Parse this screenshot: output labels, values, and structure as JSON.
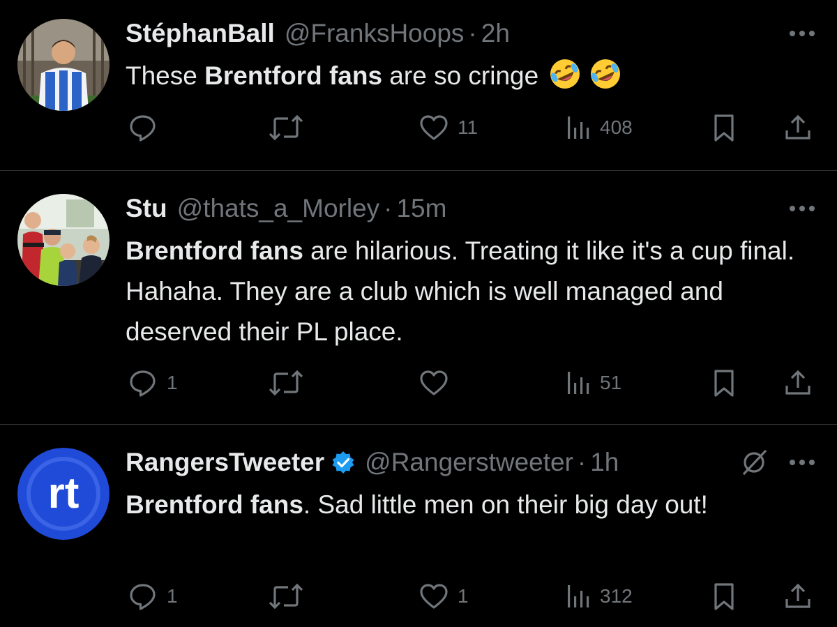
{
  "tweets": [
    {
      "name": "StéphanBall",
      "handle": "@FranksHoops",
      "dot": "·",
      "time": "2h",
      "verified": false,
      "muted": false,
      "body": [
        {
          "text": "These ",
          "bold": false
        },
        {
          "text": "Brentford fans",
          "bold": true
        },
        {
          "text": " are so cringe",
          "bold": false
        }
      ],
      "emojis": [
        "rolling-on-floor-laughing",
        "rolling-on-floor-laughing"
      ],
      "stats": {
        "replies": "",
        "retweets": "",
        "likes": "11",
        "views": "408"
      }
    },
    {
      "name": "Stu",
      "handle": "@thats_a_Morley",
      "dot": "·",
      "time": "15m",
      "verified": false,
      "muted": false,
      "body": [
        {
          "text": "Brentford fans",
          "bold": true
        },
        {
          "text": " are hilarious. Treating it like it's a cup final. Hahaha. They are a club which is well managed and deserved their PL place.",
          "bold": false
        }
      ],
      "stats": {
        "replies": "1",
        "retweets": "",
        "likes": "",
        "views": "51"
      }
    },
    {
      "name": "RangersTweeter",
      "handle": "@Rangerstweeter",
      "dot": "·",
      "time": "1h",
      "verified": true,
      "muted": true,
      "avatar_text": "rt",
      "body": [
        {
          "text": "Brentford fans",
          "bold": true
        },
        {
          "text": ". Sad little men on their big day out!",
          "bold": false
        }
      ],
      "stats": {
        "replies": "1",
        "retweets": "",
        "likes": "1",
        "views": "312"
      }
    }
  ],
  "icons": [
    "reply-icon",
    "retweet-icon",
    "like-icon",
    "views-icon",
    "bookmark-icon",
    "share-icon",
    "more-icon",
    "mute-icon",
    "verified-badge-icon"
  ],
  "colors": {
    "background": "#000000",
    "text": "#e7e9ea",
    "muted_text": "#71767b",
    "divider": "#2f3336",
    "verified": "#1d9bf0",
    "rt_avatar": "#1f4bd8"
  }
}
